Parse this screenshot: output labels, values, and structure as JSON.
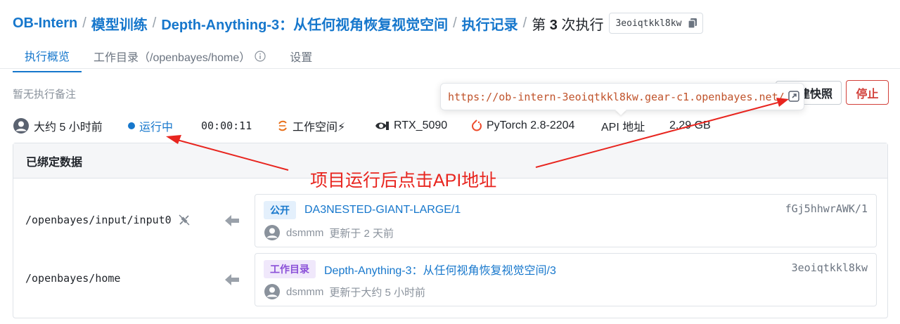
{
  "breadcrumb": {
    "items": [
      "OB-Intern",
      "模型训练",
      "Depth-Anything-3：从任何视角恢复视觉空间",
      "执行记录"
    ],
    "current_prefix": "第",
    "current_number": "3",
    "current_suffix": "次执行",
    "job_id": "3eoiqtkkl8kw"
  },
  "tabs": [
    {
      "label": "执行概览",
      "active": true
    },
    {
      "label": "工作目录（/openbayes/home）",
      "active": false
    },
    {
      "label": "设置",
      "active": false
    }
  ],
  "note": "暂无执行备注",
  "actions": {
    "snapshot_label": "建快照",
    "stop_label": "停止"
  },
  "tooltip": {
    "url": "https://ob-intern-3eoiqtkkl8kw.gear-c1.openbayes.net/"
  },
  "status": {
    "time_ago": "大约 5 小时前",
    "state": "运行中",
    "duration": "00:00:11",
    "mode": "工作空间⚡",
    "gpu": "RTX_5090",
    "image": "PyTorch 2.8-2204",
    "api_label": "API 地址",
    "size": "2.29 GB"
  },
  "bound_data": {
    "title": "已绑定数据",
    "rows": [
      {
        "path": "/openbayes/input/input0",
        "badge": "公开",
        "name": "DA3NESTED-GIANT-LARGE/1",
        "hash": "fGj5hhwrAWK/1",
        "user": "dsmmm",
        "updated": "更新于 2 天前"
      },
      {
        "path": "/openbayes/home",
        "badge": "工作目录",
        "name": "Depth-Anything-3：从任何视角恢复视觉空间/3",
        "hash": "3eoiqtkkl8kw",
        "user": "dsmmm",
        "updated": "更新于大约 5 小时前"
      }
    ]
  },
  "annotation": {
    "text": "项目运行后点击API地址",
    "color": "#e8251f"
  },
  "colors": {
    "accent": "#1677cc",
    "danger": "#d2403a",
    "url": "#c0532b"
  }
}
